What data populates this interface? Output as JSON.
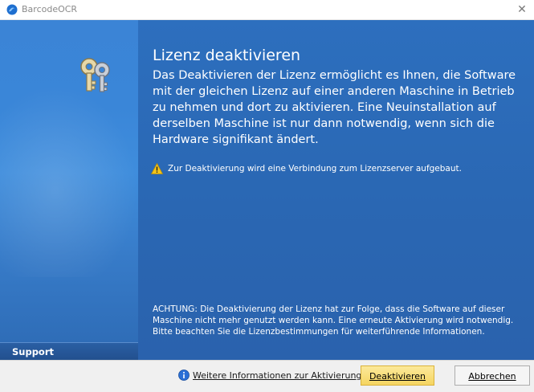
{
  "window": {
    "title": "BarcodeOCR",
    "close_label": "✕"
  },
  "sidebar": {
    "support_label": "Support"
  },
  "main": {
    "heading": "Lizenz deaktivieren",
    "description": "Das Deaktivieren der Lizenz ermöglicht es Ihnen, die Software mit der gleichen Lizenz auf einer anderen Maschine in Betrieb zu nehmen und dort zu aktivieren. Eine Neuinstallation auf derselben Maschine ist nur dann notwendig, wenn sich die Hardware signifikant ändert.",
    "warning": "Zur Deaktivierung wird eine Verbindung zum Lizenzserver aufgebaut.",
    "notice": "ACHTUNG: Die Deaktivierung der Lizenz hat zur Folge, dass die Software auf dieser Maschine nicht mehr genutzt werden kann. Eine erneute Aktivierung wird notwendig. Bitte beachten Sie die Lizenzbestimmungen für weiterführende Informationen."
  },
  "footer": {
    "info_link": "Weitere Informationen zur Aktivierung",
    "deactivate_label": "Deaktivieren",
    "cancel_label": "Abbrechen"
  },
  "colors": {
    "panel_blue": "#2d6fbe",
    "sidebar_blue": "#3a86d8",
    "primary_button": "#f5d561"
  }
}
